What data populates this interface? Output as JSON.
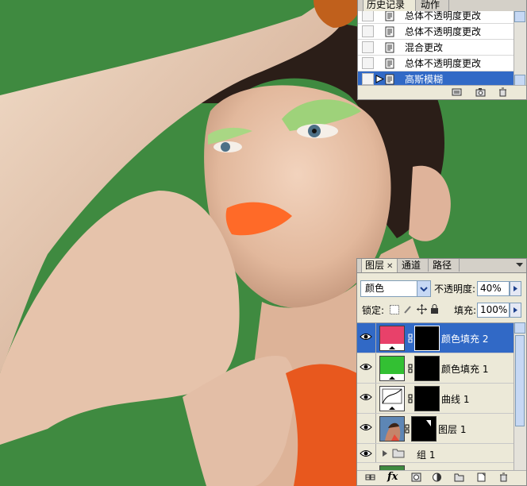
{
  "history": {
    "tabs": [
      {
        "label": "历史记录",
        "active": true,
        "closable": true
      },
      {
        "label": "动作",
        "active": false
      }
    ],
    "items": [
      {
        "label": "总体不透明度更改",
        "selected": false
      },
      {
        "label": "总体不透明度更改",
        "selected": false
      },
      {
        "label": "混合更改",
        "selected": false
      },
      {
        "label": "总体不透明度更改",
        "selected": false
      },
      {
        "label": "高斯模糊",
        "selected": true
      }
    ]
  },
  "layers": {
    "tabs": [
      {
        "label": "图层",
        "active": true,
        "closable": true
      },
      {
        "label": "通道",
        "active": false
      },
      {
        "label": "路径",
        "active": false
      }
    ],
    "blend_mode": "颜色",
    "opacity_label": "不透明度:",
    "opacity_value": "40%",
    "lock_label": "锁定:",
    "fill_label": "填充:",
    "fill_value": "100%",
    "items": [
      {
        "name": "颜色填充 2",
        "type": "color-fill",
        "color": "#e8416a",
        "visible": true,
        "selected": true
      },
      {
        "name": "颜色填充 1",
        "type": "color-fill",
        "color": "#33c033",
        "visible": true,
        "selected": false
      },
      {
        "name": "曲线 1",
        "type": "curves",
        "visible": true,
        "selected": false
      },
      {
        "name": "图层 1",
        "type": "image",
        "visible": true,
        "selected": false
      },
      {
        "name": "组 1",
        "type": "group",
        "visible": true,
        "selected": false
      }
    ],
    "footer_icons": [
      "link-icon",
      "fx-icon",
      "add-mask-icon",
      "adjustment-layer-icon",
      "new-group-icon",
      "new-layer-icon",
      "trash-icon"
    ]
  },
  "colors": {
    "background_green": "#3f8a40",
    "selection_blue": "#3169c6",
    "panel_gray": "#ece9d8"
  }
}
